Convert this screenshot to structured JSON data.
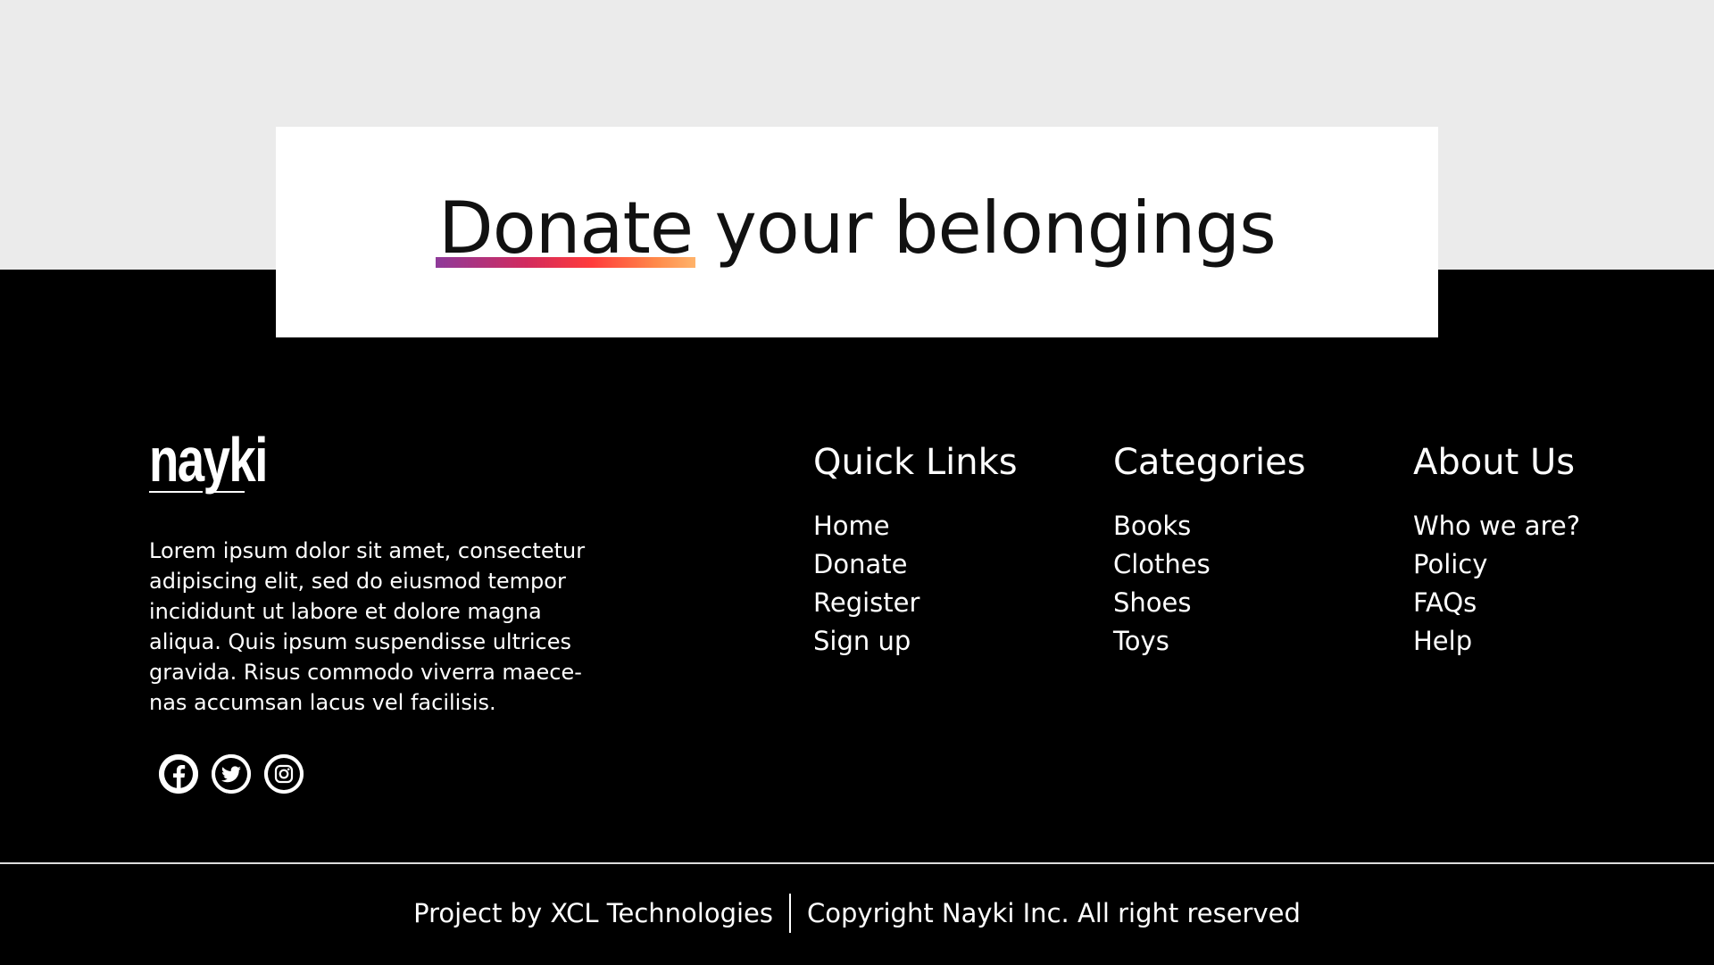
{
  "banner": {
    "heading_highlight": "Donate",
    "heading_rest": " your belongings"
  },
  "footer": {
    "logo": "nayki",
    "description": "Lorem ipsum dolor sit amet, consectetur adipiscing elit, sed do eiusmod tempor incididunt ut labore et dolore magna aliqua. Quis ipsum suspendisse ultrices gravida. Risus commodo viverra maece-nas accumsan lacus vel facilisis.",
    "socials": [
      "facebook-icon",
      "twitter-icon",
      "instagram-icon"
    ],
    "quick_links": {
      "title": "Quick Links",
      "items": [
        "Home",
        "Donate",
        "Register",
        "Sign up"
      ]
    },
    "categories": {
      "title": "Categories",
      "items": [
        "Books",
        "Clothes",
        "Shoes",
        "Toys"
      ]
    },
    "about_us": {
      "title": "About Us",
      "items": [
        "Who we are?",
        "Policy",
        "FAQs",
        "Help"
      ]
    },
    "bottom": {
      "project": "Project by XCL Technologies",
      "copyright": "Copyright Nayki Inc. All right reserved"
    }
  },
  "colors": {
    "top_background": "#ebebeb",
    "footer_background": "#000000",
    "card_background": "#ffffff",
    "underline_gradient": [
      "#8e3a9a",
      "#d22b5e",
      "#ff3b3b",
      "#ff8a4a",
      "#ffb36a"
    ]
  }
}
